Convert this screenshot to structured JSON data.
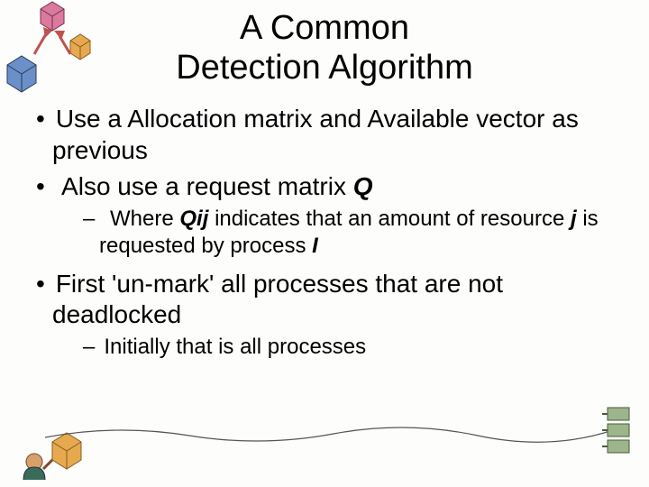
{
  "title_line1": "A Common",
  "title_line2": "Detection Algorithm",
  "bullets": {
    "b1": "Use a Allocation matrix and Available vector  as previous",
    "b2_pre": "Also use a request matrix ",
    "b2_em": "Q",
    "b2_sub_pre": "Where ",
    "b2_sub_em": "Qij",
    "b2_sub_mid": " indicates that an amount of resource ",
    "b2_sub_em2": "j",
    "b2_sub_mid2": " is requested by process ",
    "b2_sub_em3": "I",
    "b3": "First 'un-mark' all processes that are not deadlocked",
    "b3_sub": "Initially that is all processes"
  },
  "colors": {
    "cube_blue": "#6b8fc9",
    "cube_pink": "#d97a9e",
    "cube_orange": "#e6a94f",
    "arrow": "#c0504d",
    "line": "#555555",
    "box_green": "#9cb58a"
  }
}
